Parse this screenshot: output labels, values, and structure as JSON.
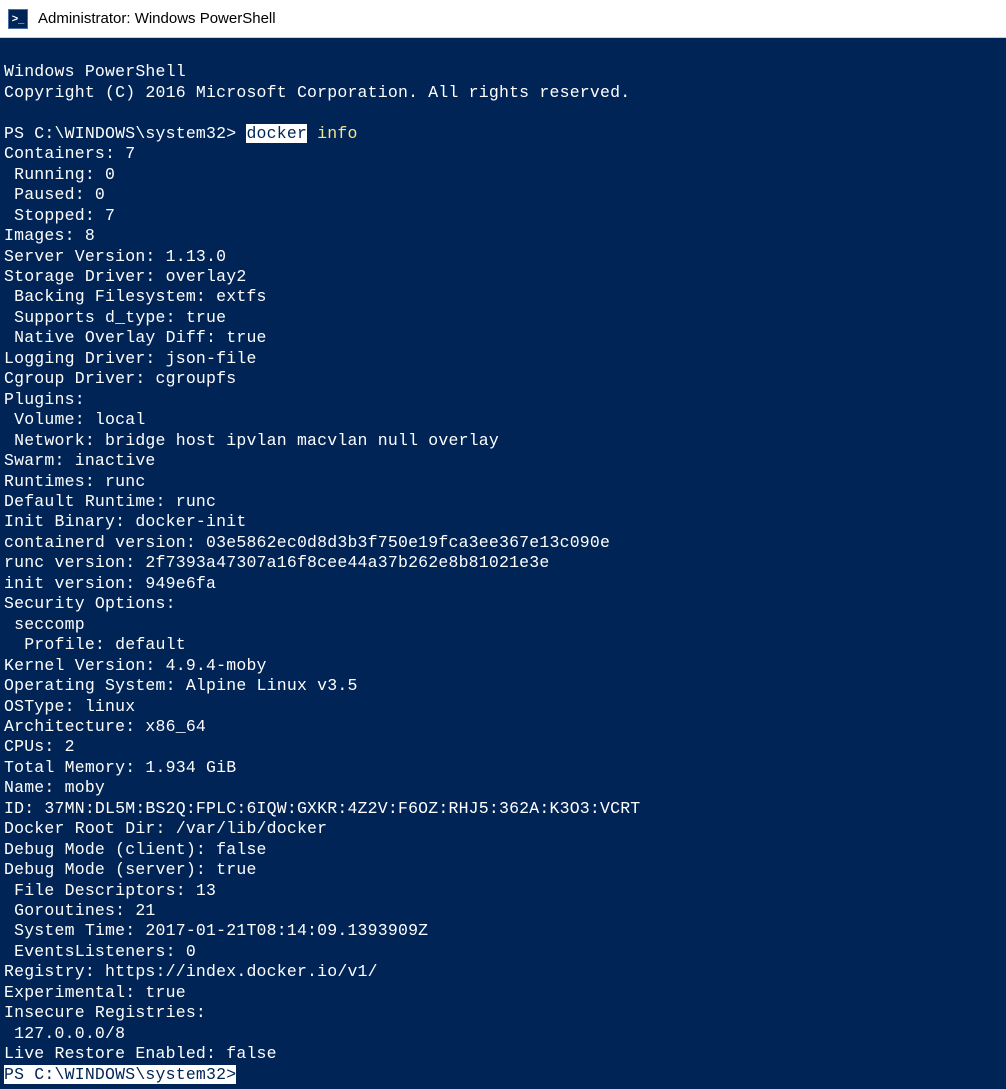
{
  "titlebar": {
    "icon_glyph": ">_",
    "text": "Administrator: Windows PowerShell"
  },
  "terminal": {
    "header1": "Windows PowerShell",
    "header2": "Copyright (C) 2016 Microsoft Corporation. All rights reserved.",
    "prompt1_prefix": "PS C:\\WINDOWS\\system32> ",
    "prompt1_cmd": "docker",
    "prompt1_args": " info",
    "lines": [
      "Containers: 7",
      " Running: 0",
      " Paused: 0",
      " Stopped: 7",
      "Images: 8",
      "Server Version: 1.13.0",
      "Storage Driver: overlay2",
      " Backing Filesystem: extfs",
      " Supports d_type: true",
      " Native Overlay Diff: true",
      "Logging Driver: json-file",
      "Cgroup Driver: cgroupfs",
      "Plugins:",
      " Volume: local",
      " Network: bridge host ipvlan macvlan null overlay",
      "Swarm: inactive",
      "Runtimes: runc",
      "Default Runtime: runc",
      "Init Binary: docker-init",
      "containerd version: 03e5862ec0d8d3b3f750e19fca3ee367e13c090e",
      "runc version: 2f7393a47307a16f8cee44a37b262e8b81021e3e",
      "init version: 949e6fa",
      "Security Options:",
      " seccomp",
      "  Profile: default",
      "Kernel Version: 4.9.4-moby",
      "Operating System: Alpine Linux v3.5",
      "OSType: linux",
      "Architecture: x86_64",
      "CPUs: 2",
      "Total Memory: 1.934 GiB",
      "Name: moby",
      "ID: 37MN:DL5M:BS2Q:FPLC:6IQW:GXKR:4Z2V:F6OZ:RHJ5:362A:K3O3:VCRT",
      "Docker Root Dir: /var/lib/docker",
      "Debug Mode (client): false",
      "Debug Mode (server): true",
      " File Descriptors: 13",
      " Goroutines: 21",
      " System Time: 2017-01-21T08:14:09.1393909Z",
      " EventsListeners: 0",
      "Registry: https://index.docker.io/v1/",
      "Experimental: true",
      "Insecure Registries:",
      " 127.0.0.0/8",
      "Live Restore Enabled: false"
    ],
    "prompt2": "PS C:\\WINDOWS\\system32>"
  }
}
